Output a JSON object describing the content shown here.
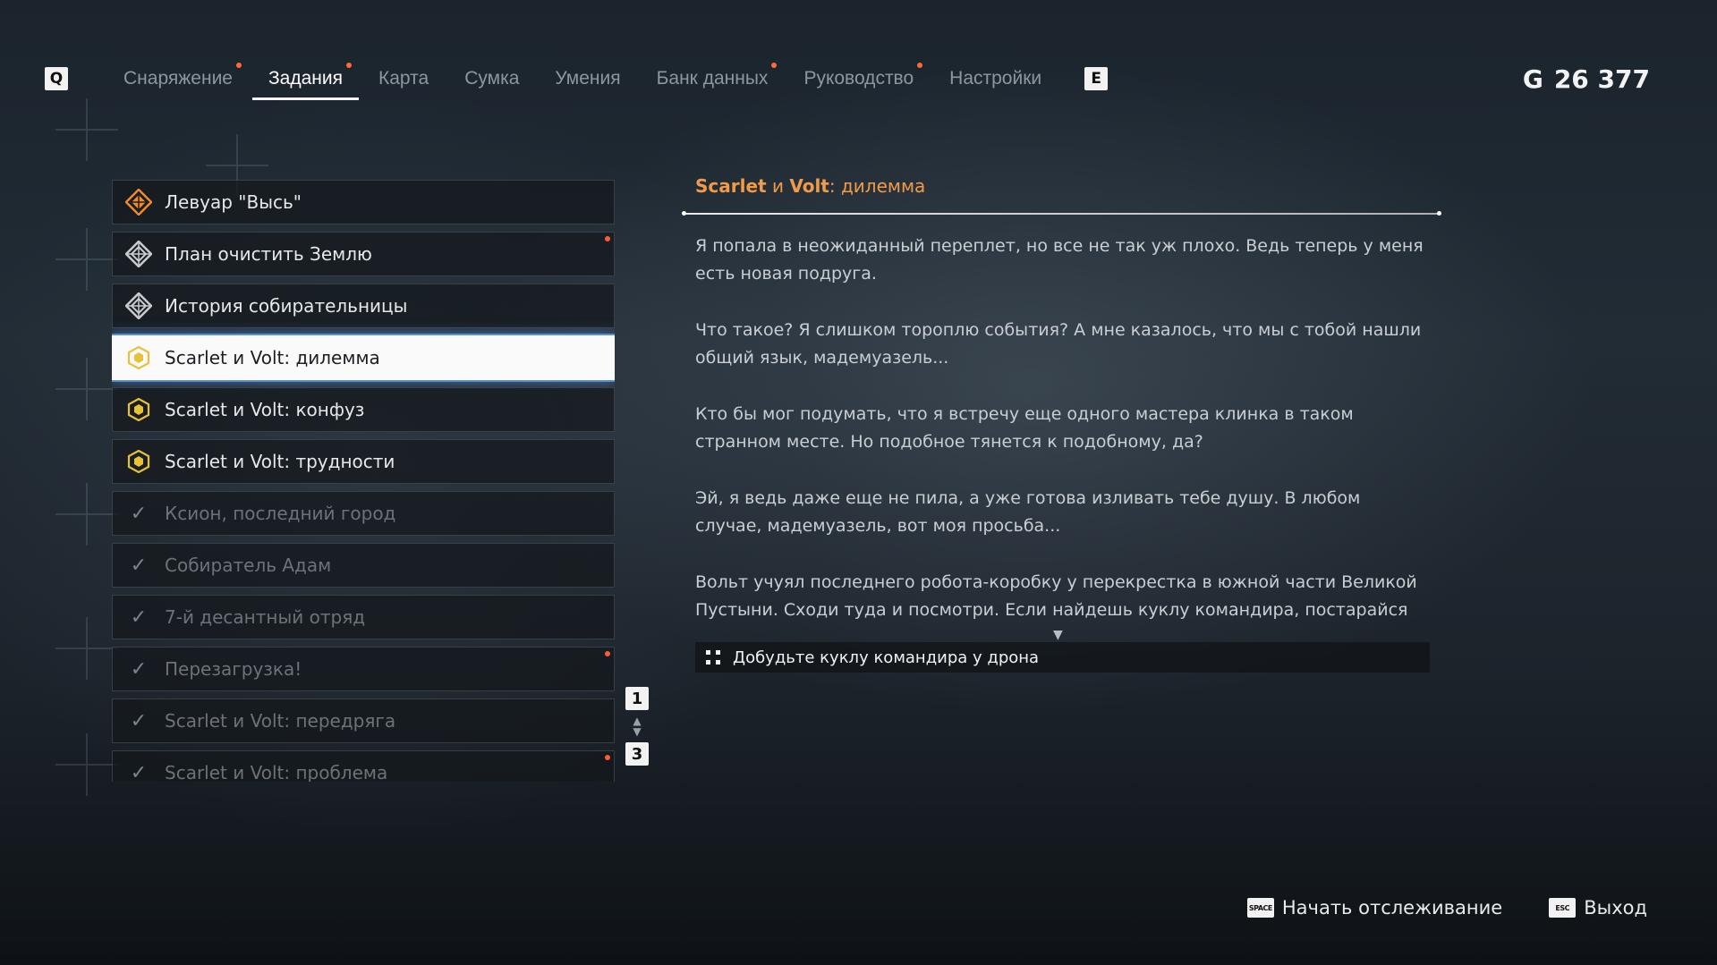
{
  "nav": {
    "left_key": "Q",
    "right_key": "E",
    "tabs": [
      {
        "label": "Снаряжение",
        "active": false,
        "dot": true
      },
      {
        "label": "Задания",
        "active": true,
        "dot": true
      },
      {
        "label": "Карта",
        "active": false,
        "dot": false
      },
      {
        "label": "Сумка",
        "active": false,
        "dot": false
      },
      {
        "label": "Умения",
        "active": false,
        "dot": false
      },
      {
        "label": "Банк данных",
        "active": false,
        "dot": true
      },
      {
        "label": "Руководство",
        "active": false,
        "dot": true
      },
      {
        "label": "Настройки",
        "active": false,
        "dot": false
      }
    ]
  },
  "currency": {
    "icon": "G",
    "value": "26 377"
  },
  "quests": [
    {
      "label": "Левуар \"Высь\"",
      "icon": "main-quest-icon",
      "state": "active",
      "dot": false
    },
    {
      "label": "План очистить Землю",
      "icon": "side-quest-icon",
      "state": "active",
      "dot": true
    },
    {
      "label": "История собирательницы",
      "icon": "side-quest-icon",
      "state": "active",
      "dot": false
    },
    {
      "label": "Scarlet и Volt: дилемма",
      "icon": "request-quest-icon",
      "state": "selected",
      "dot": false
    },
    {
      "label": "Scarlet и Volt: конфуз",
      "icon": "request-quest-icon",
      "state": "active",
      "dot": false
    },
    {
      "label": "Scarlet и Volt: трудности",
      "icon": "request-quest-icon",
      "state": "active",
      "dot": false
    },
    {
      "label": "Ксион, последний город",
      "icon": "check-icon",
      "state": "done",
      "dot": false
    },
    {
      "label": "Собиратель Адам",
      "icon": "check-icon",
      "state": "done",
      "dot": false
    },
    {
      "label": "7-й десантный отряд",
      "icon": "check-icon",
      "state": "done",
      "dot": false
    },
    {
      "label": "Перезагрузка!",
      "icon": "check-icon",
      "state": "done",
      "dot": true
    },
    {
      "label": "Scarlet и Volt: передряга",
      "icon": "check-icon",
      "state": "done",
      "dot": false
    },
    {
      "label": "Scarlet и Volt: проблема",
      "icon": "check-icon",
      "state": "done",
      "dot": true
    }
  ],
  "pager": {
    "up_key": "1",
    "down_key": "3"
  },
  "details": {
    "title_prefix": "Scarlet",
    "title_mid": " и ",
    "title_accent": "Volt",
    "title_suffix": ": дилемма",
    "paragraphs": [
      "Я попала в неожиданный переплет, но все не так уж плохо. Ведь теперь у меня есть новая подруга.",
      "Что такое? Я слишком тороплю события? А мне казалось, что мы с тобой нашли общий язык, мадемуазель...",
      "Кто бы мог подумать, что я встречу еще одного мастера клинка в таком странном месте. Но подобное тянется к подобному, да?",
      "Эй, я ведь даже еще не пила, а уже готова изливать тебе душу. В любом случае, мадемуазель, вот моя просьба...",
      "Вольт учуял последнего робота-коробку у перекрестка в южной части Великой Пустыни. Сходи туда и посмотри. Если найдешь куклу командира, постарайся ее"
    ],
    "objective": "Добудьте куклу командира у дрона"
  },
  "controls": [
    {
      "key": "SPACE",
      "label": "Начать отслеживание"
    },
    {
      "key": "ESC",
      "label": "Выход"
    }
  ],
  "colors": {
    "accent_orange": "#f09a4a",
    "notify_dot": "#ff5a3a",
    "request_icon": "#e8c13a",
    "main_icon": "#f08a2a"
  }
}
